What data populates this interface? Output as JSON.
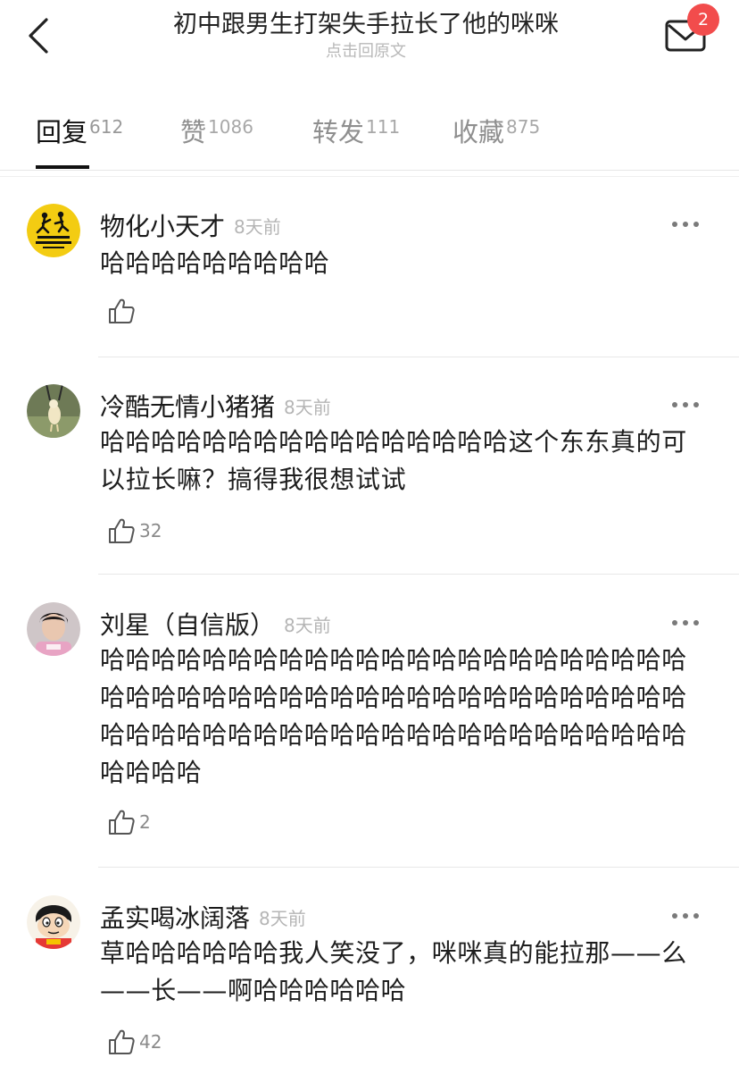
{
  "header": {
    "title": "初中跟男生打架失手拉长了他的咪咪",
    "subtitle": "点击回原文",
    "mail_badge": "2"
  },
  "tabs": [
    {
      "label": "回复",
      "count": "612",
      "active": true
    },
    {
      "label": "赞",
      "count": "1086",
      "active": false
    },
    {
      "label": "转发",
      "count": "111",
      "active": false
    },
    {
      "label": "收藏",
      "count": "875",
      "active": false
    }
  ],
  "comments": [
    {
      "username": "物化小天才",
      "time": "8天前",
      "text": "哈哈哈哈哈哈哈哈哈",
      "likes": ""
    },
    {
      "username": "冷酷无情小猪猪",
      "time": "8天前",
      "text": "哈哈哈哈哈哈哈哈哈哈哈哈哈哈哈哈这个东东真的可以拉长嘛？搞得我很想试试",
      "likes": "32"
    },
    {
      "username": "刘星（自信版）",
      "time": "8天前",
      "text": "哈哈哈哈哈哈哈哈哈哈哈哈哈哈哈哈哈哈哈哈哈哈哈哈哈哈哈哈哈哈哈哈哈哈哈哈哈哈哈哈哈哈哈哈哈哈哈哈哈哈哈哈哈哈哈哈哈哈哈哈哈哈哈哈哈哈哈哈哈哈哈哈哈",
      "likes": "2"
    },
    {
      "username": "孟实喝冰阔落",
      "time": "8天前",
      "text": "草哈哈哈哈哈哈我人笑没了，咪咪真的能拉那——么——长——啊哈哈哈哈哈哈",
      "likes": "42"
    }
  ],
  "colors": {
    "badge": "#f24c4c",
    "text_primary": "#1a1a1a",
    "text_secondary": "#b5b5b5",
    "divider": "#e8e8e8"
  },
  "icons": [
    "back-arrow-icon",
    "mail-icon",
    "more-icon",
    "thumbs-up-icon"
  ]
}
